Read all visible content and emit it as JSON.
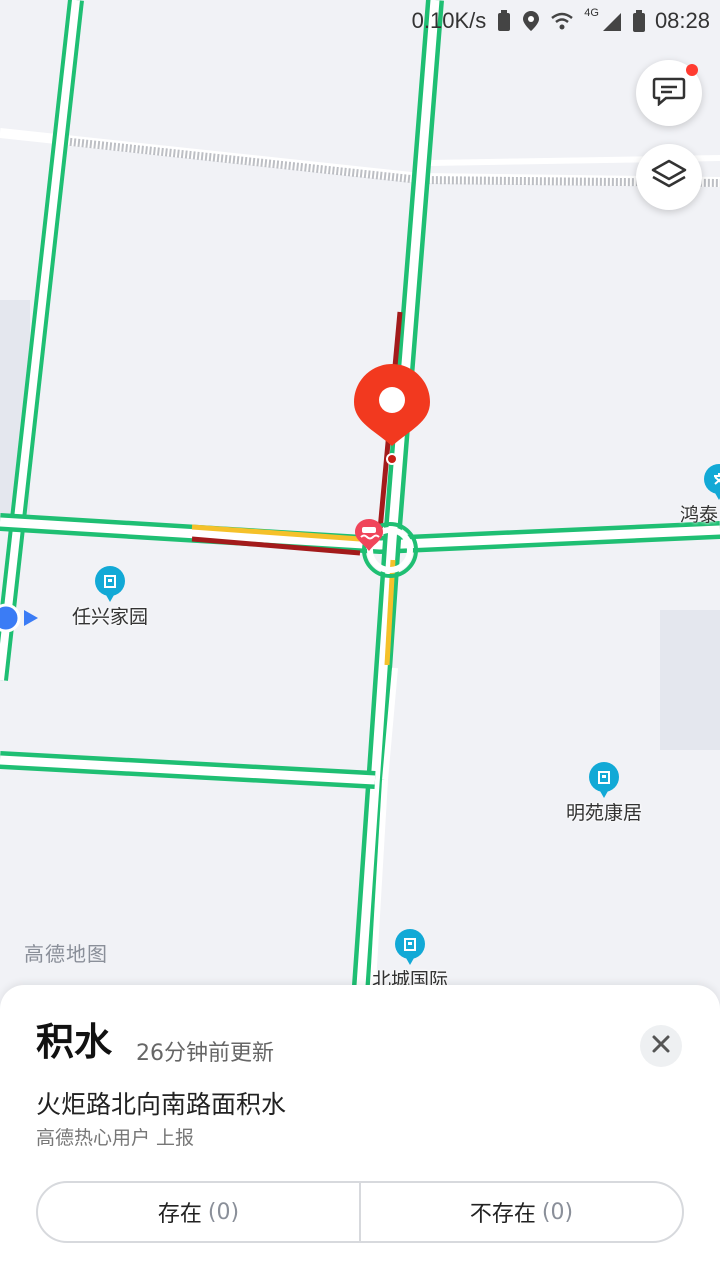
{
  "status_bar": {
    "speed": "0.10K/s",
    "network": "4G",
    "time": "08:28"
  },
  "map": {
    "watermark": "高德地图",
    "pois": [
      {
        "name": "任兴家园"
      },
      {
        "name": "明苑康居"
      },
      {
        "name": "北城国际"
      },
      {
        "name": "鸿泰"
      }
    ]
  },
  "colors": {
    "road_smooth": "#1fbf73",
    "road_slow": "#f5c12a",
    "road_congested": "#a31b1b",
    "marker_red": "#f2391f",
    "poi_blue": "#12a9d6",
    "location_blue": "#3b7cf5"
  },
  "buttons": {
    "feedback_icon": "message-icon",
    "layers_icon": "layers-icon"
  },
  "incident": {
    "title": "积水",
    "updated": "26分钟前更新",
    "description": "火炬路北向南路面积水",
    "source": "高德热心用户 上报",
    "yes_label": "存在",
    "yes_count": "(0)",
    "no_label": "不存在",
    "no_count": "(0)"
  }
}
